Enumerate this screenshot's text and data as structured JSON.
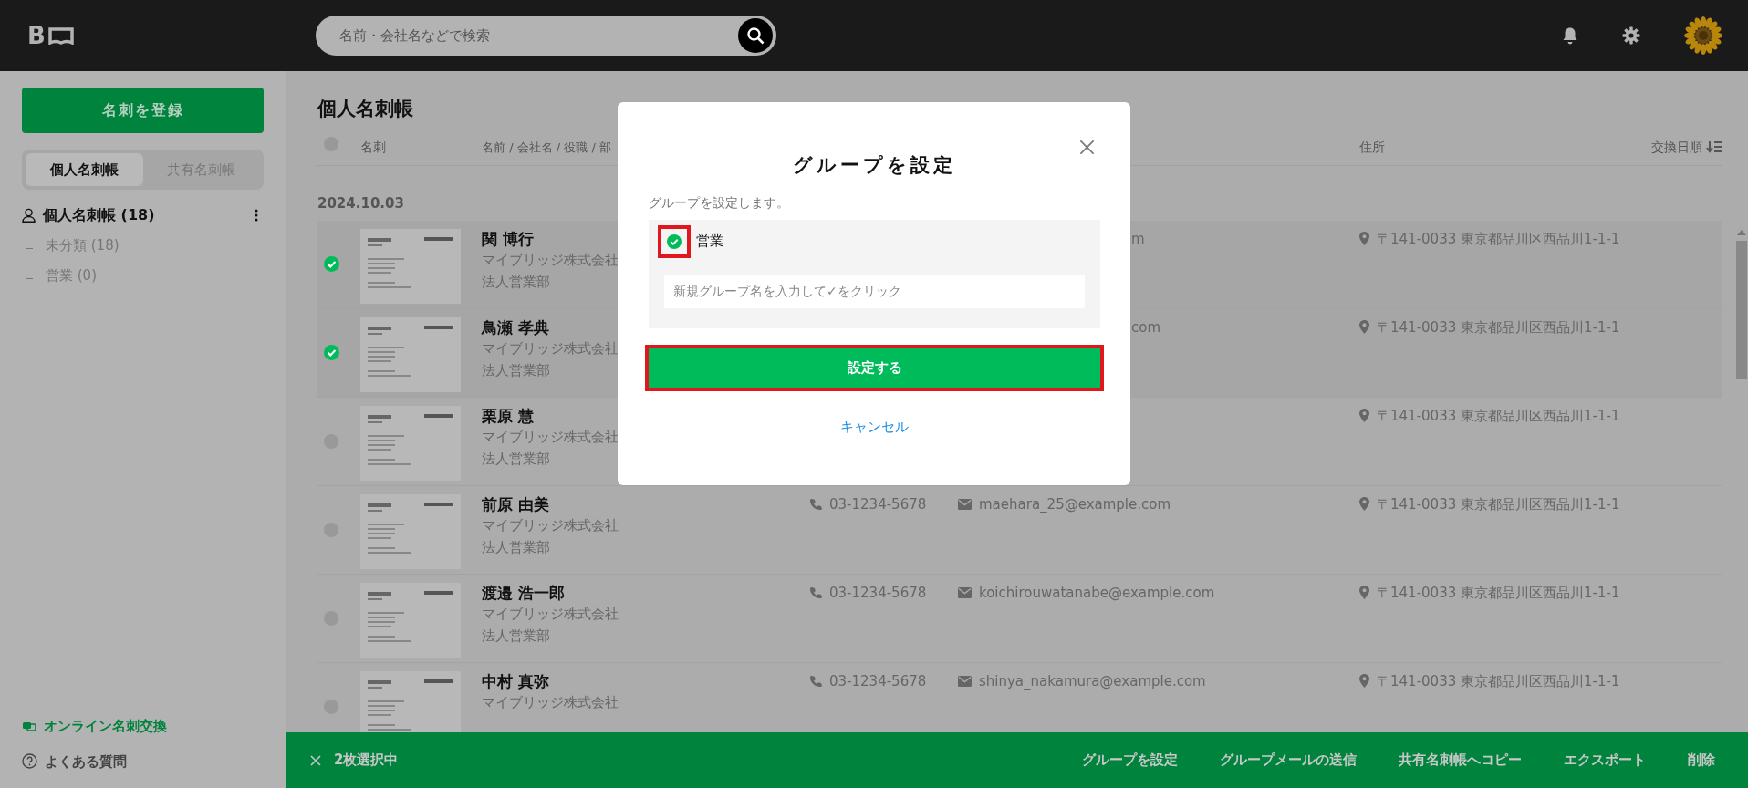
{
  "header": {
    "logo": "B",
    "search": {
      "placeholder": "名前・会社名などで検索"
    }
  },
  "sidebar": {
    "register_button": "名刺を登録",
    "tabs": [
      {
        "label": "個人名刺帳",
        "selected": true
      },
      {
        "label": "共有名刺帳",
        "selected": false
      }
    ],
    "tree": [
      {
        "label": "個人名刺帳 (18)",
        "children": [
          {
            "label": "未分類 (18)"
          },
          {
            "label": "営業 (0)"
          }
        ]
      }
    ],
    "footer_links": [
      {
        "kind": "exchange",
        "label": "オンライン名刺交換"
      },
      {
        "kind": "help",
        "label": "よくある質問"
      }
    ]
  },
  "main": {
    "title": "個人名刺帳",
    "select_all": {
      "checked": false
    },
    "columns": [
      "名刺",
      "名前 / 会社名 / 役職 / 部",
      "住所"
    ],
    "sort": "交換日順",
    "date": "2024.10.03",
    "rows": [
      {
        "selected": true,
        "name": "関 博行",
        "company": "マイブリッジ株式会社",
        "department": "法人営業部",
        "email_fragment": "m",
        "address": "〒141-0033 東京都品川区西品川1-1-1"
      },
      {
        "selected": true,
        "name": "鳥瀬 孝典",
        "company": "マイブリッジ株式会社",
        "department": "法人営業部",
        "email_fragment": "com",
        "address": "〒141-0033 東京都品川区西品川1-1-1"
      },
      {
        "selected": false,
        "name": "栗原 慧",
        "company": "マイブリッジ株式会社",
        "department": "法人営業部",
        "address": "〒141-0033 東京都品川区西品川1-1-1"
      },
      {
        "selected": false,
        "name": "前原 由美",
        "company": "マイブリッジ株式会社",
        "department": "法人営業部",
        "phone": "03-1234-5678",
        "email": "maehara_25@example.com",
        "address": "〒141-0033 東京都品川区西品川1-1-1"
      },
      {
        "selected": false,
        "name": "渡邉 浩一郎",
        "company": "マイブリッジ株式会社",
        "department": "法人営業部",
        "phone": "03-1234-5678",
        "email": "koichirouwatanabe@example.com",
        "address": "〒141-0033 東京都品川区西品川1-1-1"
      },
      {
        "selected": false,
        "name": "中村 真弥",
        "company": "マイブリッジ株式会社",
        "phone": "03-1234-5678",
        "email": "shinya_nakamura@example.com",
        "address": "〒141-0033 東京都品川区西品川1-1-1"
      }
    ]
  },
  "selection_bar": {
    "count_label": "2枚選択中",
    "actions": [
      "グループを設定",
      "グループメールの送信",
      "共有名刺帳へコピー",
      "エクスポート",
      "削除"
    ]
  },
  "dialog": {
    "title": "グループを設定",
    "description": "グループを設定します。",
    "groups": [
      {
        "label": "営業",
        "checked": true,
        "highlighted": true
      }
    ],
    "new_group": {
      "placeholder": "新規グループ名を入力して✓をクリック"
    },
    "submit": {
      "label": "設定する",
      "highlighted": true
    },
    "cancel": "キャンセル"
  }
}
